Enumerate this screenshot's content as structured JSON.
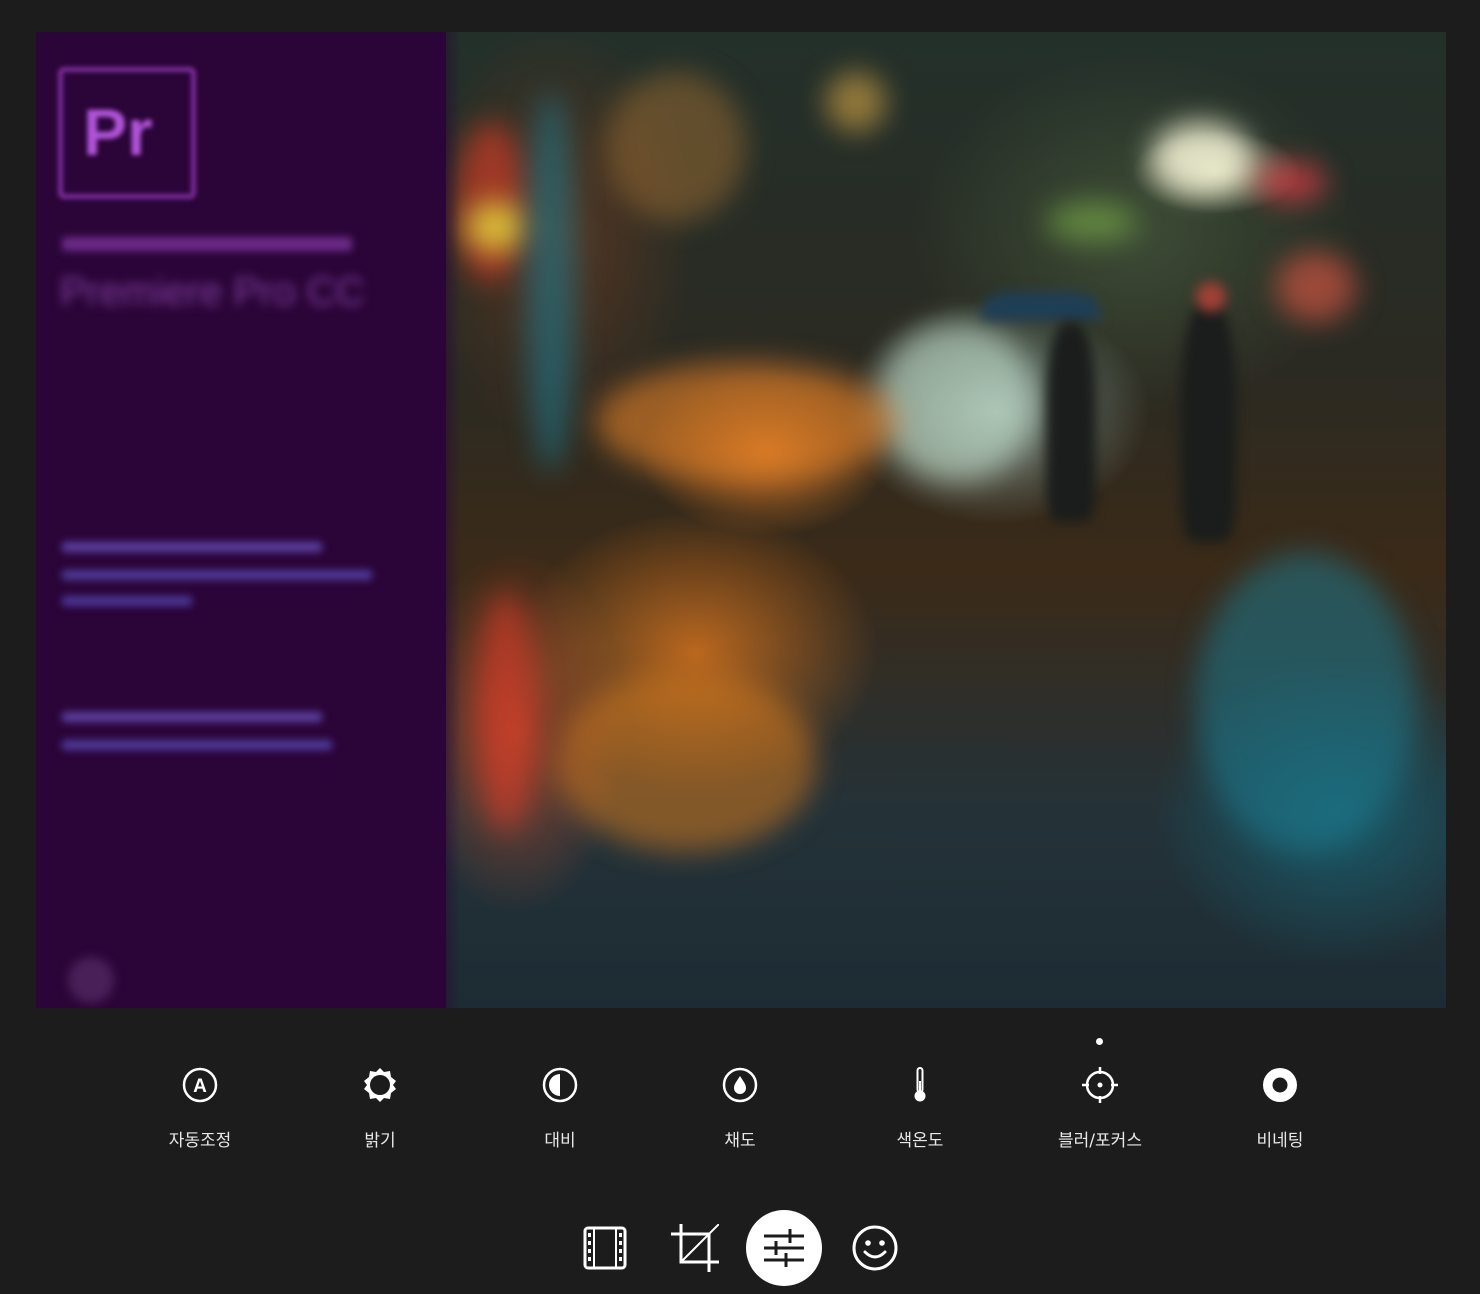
{
  "adjust_tools": [
    {
      "label": "자동조정",
      "icon": "auto-adjust-icon"
    },
    {
      "label": "밝기",
      "icon": "brightness-icon"
    },
    {
      "label": "대비",
      "icon": "contrast-icon"
    },
    {
      "label": "채도",
      "icon": "saturation-icon"
    },
    {
      "label": "색온도",
      "icon": "temperature-icon"
    },
    {
      "label": "블러/포커스",
      "icon": "focus-icon"
    },
    {
      "label": "비네팅",
      "icon": "vignette-icon"
    }
  ],
  "selected_tool": "블러/포커스",
  "mode_bar": [
    {
      "icon": "filmstrip-icon",
      "active": false
    },
    {
      "icon": "crop-icon",
      "active": false
    },
    {
      "icon": "adjust-sliders-icon",
      "active": true
    },
    {
      "icon": "smiley-icon",
      "active": false
    }
  ],
  "colors": {
    "background": "#1c1c1c",
    "splash_purple": "#2b0538",
    "text": "#e8e8e8",
    "active": "#ffffff"
  }
}
